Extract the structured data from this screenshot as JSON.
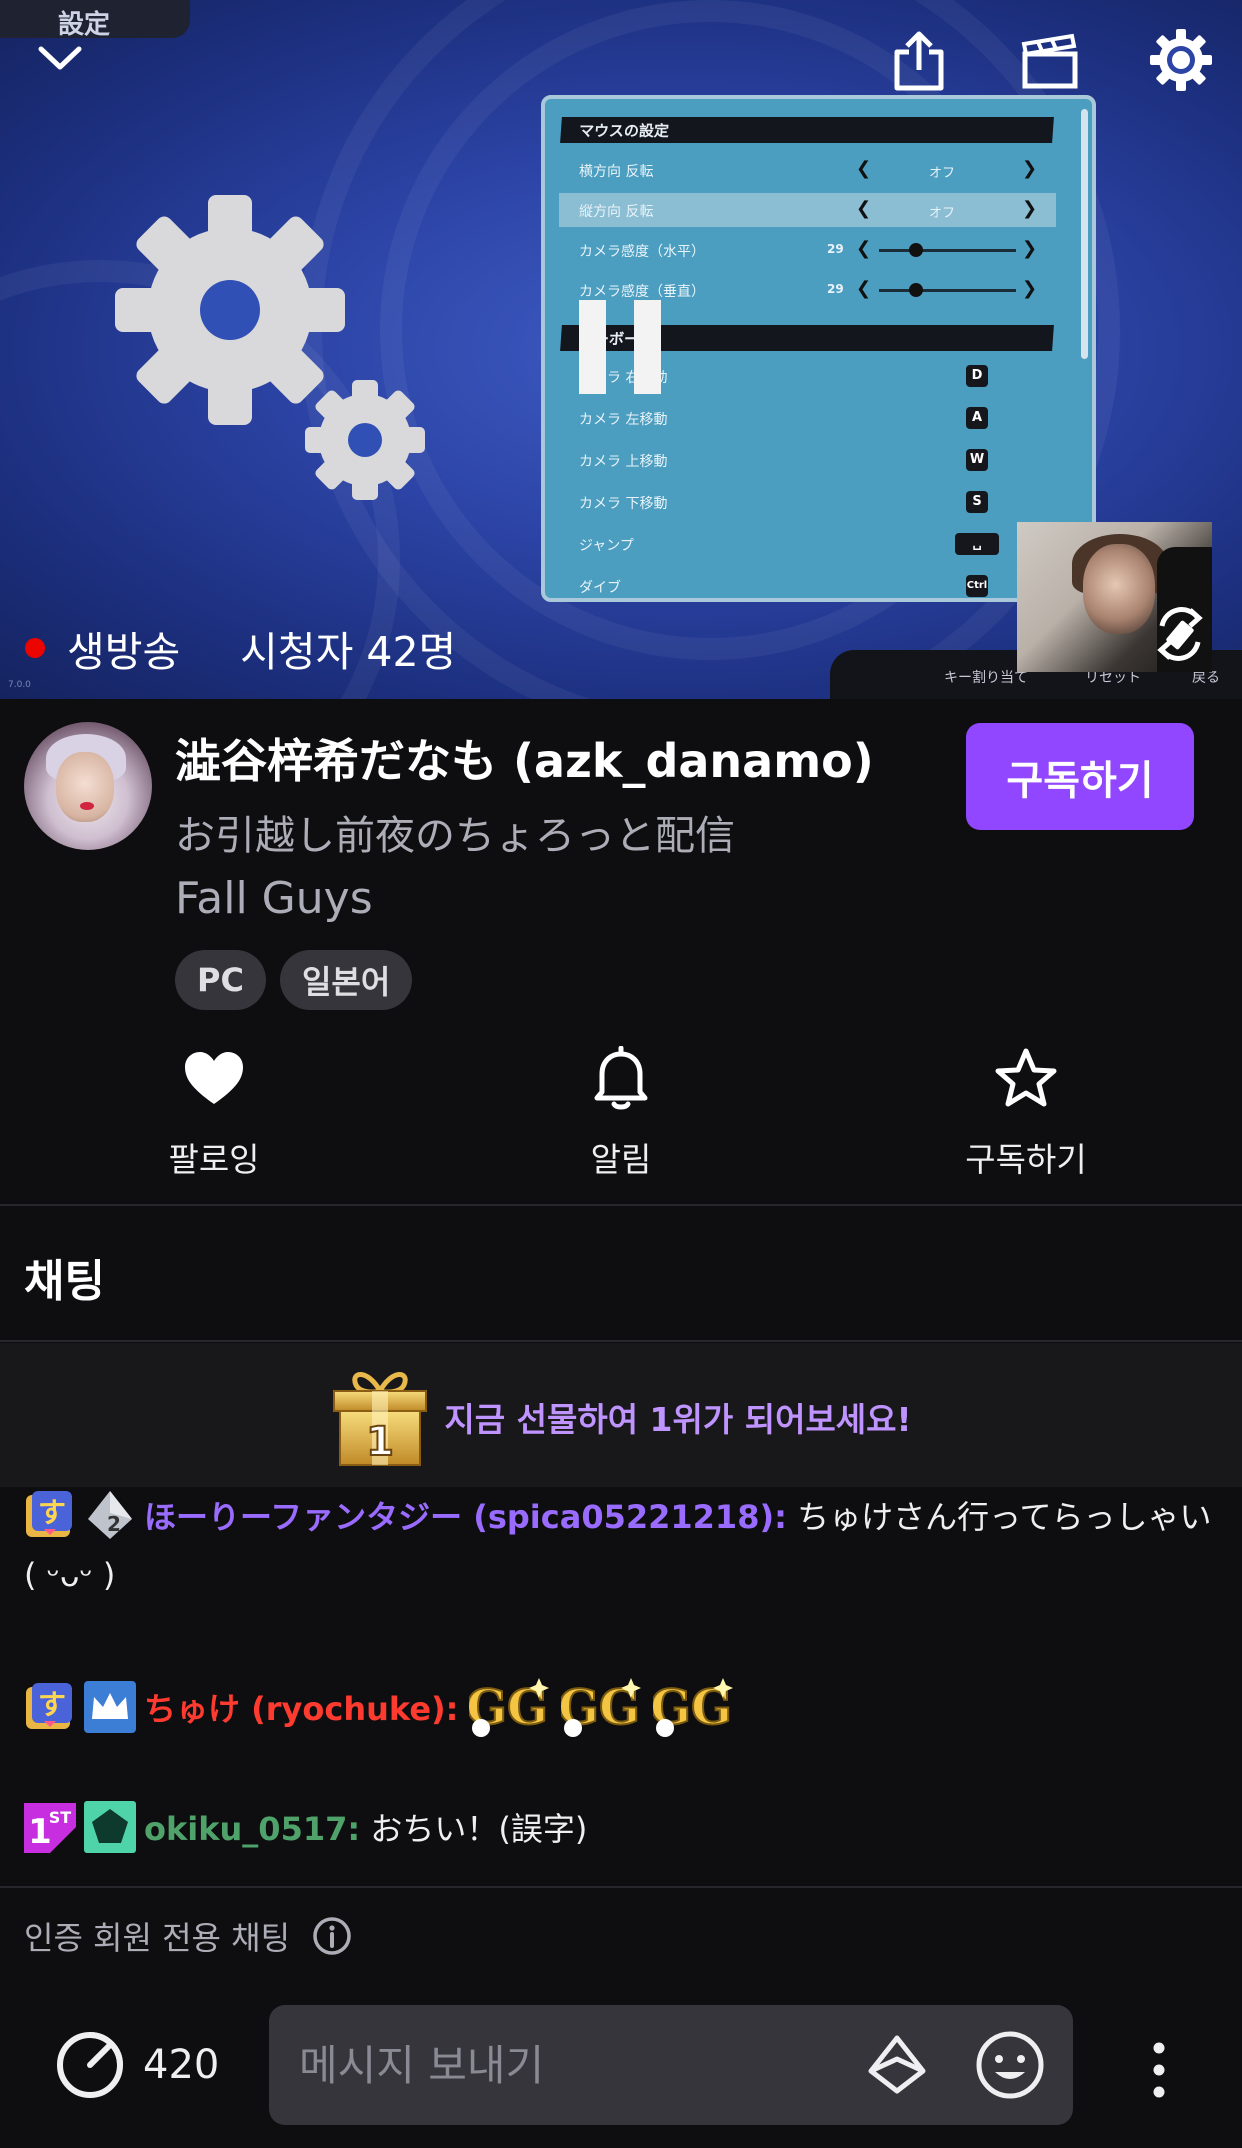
{
  "colors": {
    "accent": "#9147ff",
    "live_dot": "#eb0400",
    "gift_text": "#bf94ff",
    "user1": "#9a6bff",
    "user2": "#ff3b30",
    "user3": "#4fa36a"
  },
  "player": {
    "overlay_label": "設定",
    "live_label": "생방송",
    "viewers_label": "시청자 42명",
    "version": "7.0.0",
    "icons": {
      "collapse": "chevron-down-icon",
      "share": "share-icon",
      "clip": "clapperboard-icon",
      "settings": "gear-icon",
      "rotate": "rotate-screen-icon"
    },
    "game_menu": {
      "header_mouse": "マウスの設定",
      "header_keyboard": "キーボード",
      "rows": [
        {
          "label": "横方向 反転",
          "value": "オフ"
        },
        {
          "label": "縦方向 反転",
          "value": "オフ"
        },
        {
          "label": "カメラ感度（水平）",
          "num": "29"
        },
        {
          "label": "カメラ感度（垂直）",
          "num": "29"
        },
        {
          "label": "カメラ 右移動",
          "key": "D"
        },
        {
          "label": "カメラ 左移動",
          "key": "A"
        },
        {
          "label": "カメラ 上移動",
          "key": "W"
        },
        {
          "label": "カメラ 下移動",
          "key": "S"
        },
        {
          "label": "ジャンプ",
          "key": "␣"
        },
        {
          "label": "ダイブ",
          "key": "Ctrl"
        }
      ],
      "footer": [
        "キー割り当て",
        "リセット",
        "戻る"
      ]
    }
  },
  "channel": {
    "name": "澁谷梓希だなも (azk_danamo)",
    "title": "お引越し前夜のちょろっと配信",
    "game": "Fall Guys",
    "tags": [
      "PC",
      "일본어"
    ],
    "subscribe_button": "구독하기"
  },
  "actions": [
    {
      "label": "팔로잉",
      "icon": "heart-icon"
    },
    {
      "label": "알림",
      "icon": "bell-icon"
    },
    {
      "label": "구독하기",
      "icon": "star-icon"
    }
  ],
  "chat": {
    "title": "채팅",
    "gift_banner": "지금 선물하여 1위가 되어보세요!",
    "gift_badge_number": "1",
    "messages": [
      {
        "username": "ほーりーファンタジー (spica05221218):",
        "text": "ちゅけさん行ってらっしゃい ( ᵕᴗᵕ )",
        "badges": [
          "subscriber-badge",
          "bits-2-badge"
        ]
      },
      {
        "username": "ちゅけ (ryochuke):",
        "text": "",
        "badges": [
          "subscriber-badge",
          "crown-badge"
        ],
        "emotes": [
          "gg-emote",
          "gg-emote",
          "gg-emote"
        ]
      },
      {
        "username": "okiku_0517:",
        "text": "おちい！(誤字)",
        "badges": [
          "first-badge",
          "pentagon-badge"
        ]
      }
    ],
    "verified_only": "인증 회원 전용 채팅"
  },
  "bottom": {
    "points": "420",
    "message_placeholder": "메시지 보내기"
  }
}
